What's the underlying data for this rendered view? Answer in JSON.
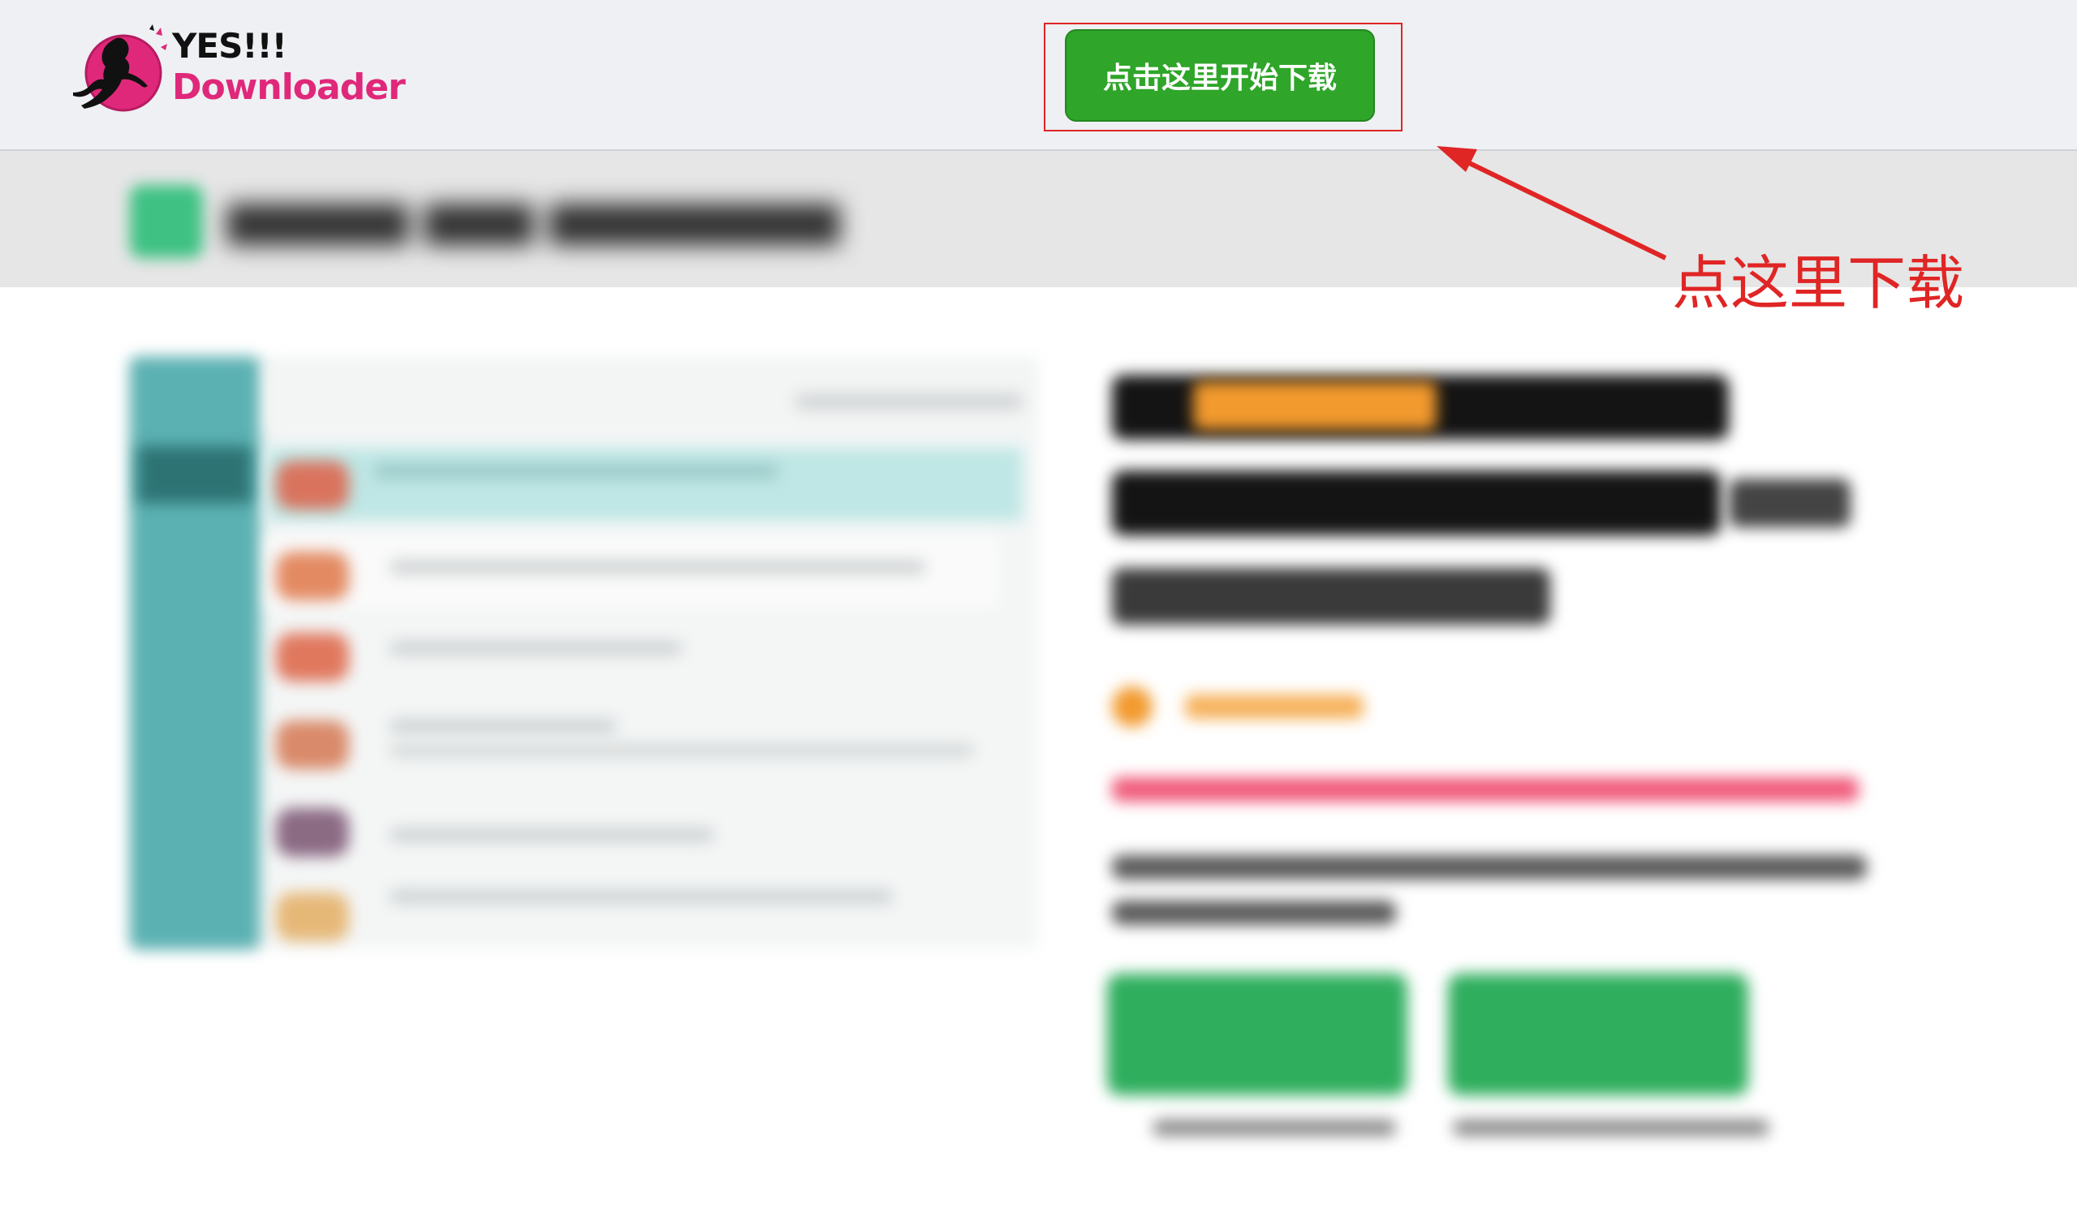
{
  "header": {
    "logo_line1": "YES!!!",
    "logo_line2": "Downloader",
    "cta_label": "点击这里开始下载"
  },
  "annotation": {
    "text": "点这里下载",
    "color": "#e02525"
  },
  "colors": {
    "brand_pink": "#e0287a",
    "cta_green": "#2fa52a",
    "header_bg": "#eef0f3"
  }
}
